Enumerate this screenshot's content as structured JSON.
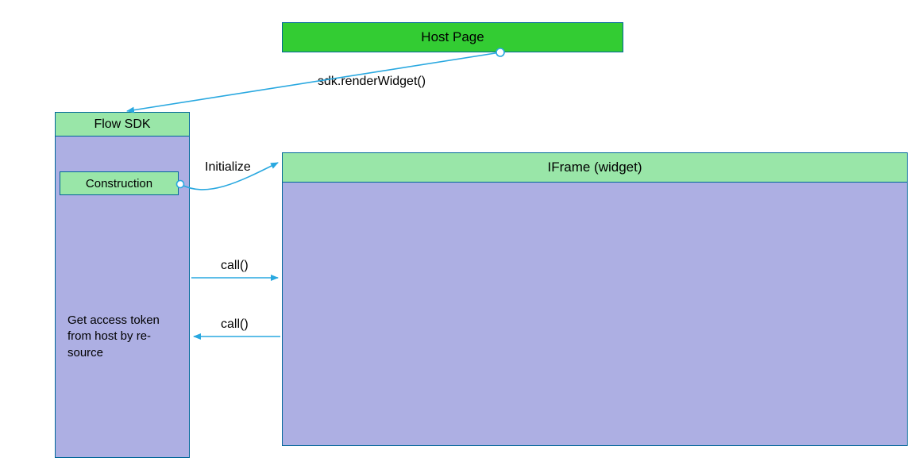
{
  "host_page": {
    "label": "Host Page"
  },
  "flow_sdk": {
    "header": "Flow SDK",
    "construction": "Construction",
    "token_text": "Get access token from host by re­source"
  },
  "iframe": {
    "header": "IFrame (widget)"
  },
  "arrows": {
    "render_widget": "sdk.renderWidget()",
    "initialize": "Initialize",
    "call1": "call()",
    "call2": "call()"
  },
  "colors": {
    "bright_green": "#33cc33",
    "light_green": "#99e6a8",
    "lilac": "#adafe3",
    "stroke": "#006699",
    "arrow": "#29a8e0"
  }
}
